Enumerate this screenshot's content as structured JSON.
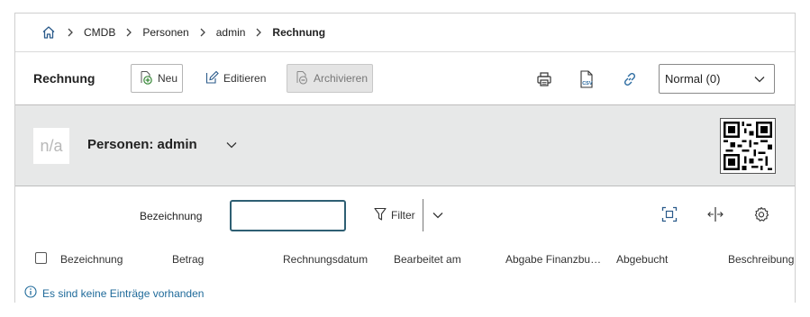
{
  "breadcrumb": {
    "items": [
      "CMDB",
      "Personen",
      "admin"
    ],
    "current": "Rechnung"
  },
  "toolbar": {
    "title": "Rechnung",
    "new_label": "Neu",
    "edit_label": "Editieren",
    "archive_label": "Archivieren",
    "view_select": "Normal (0)"
  },
  "header": {
    "avatar_text": "n/a",
    "title": "Personen: admin"
  },
  "filter": {
    "label": "Bezeichnung",
    "input_value": "",
    "filter_label": "Filter"
  },
  "table": {
    "columns": [
      "Bezeichnung",
      "Betrag",
      "Rechnungsdatum",
      "Bearbeitet am",
      "Abgabe Finanzbuchhaltung",
      "Abgebucht",
      "Beschreibung"
    ]
  },
  "empty_message": "Es sind keine Einträge vorhanden",
  "colors": {
    "accent": "#1f6a9a",
    "panel_bg": "#e7e8e8",
    "input_border": "#2e5f73"
  }
}
